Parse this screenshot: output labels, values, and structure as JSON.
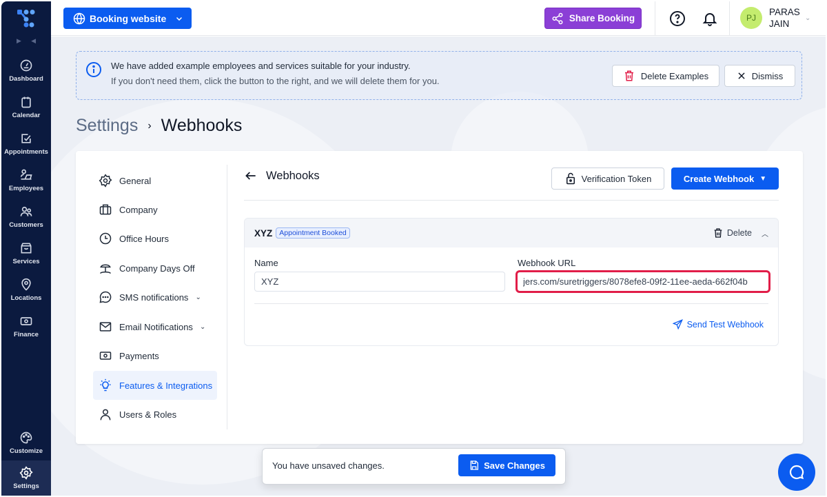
{
  "sidebar": {
    "logo": "app-logo",
    "collapse_icons": [
      "expand-icon",
      "collapse-icon"
    ],
    "items": [
      {
        "label": "Dashboard",
        "icon": "gauge-icon"
      },
      {
        "label": "Calendar",
        "icon": "calendar-icon"
      },
      {
        "label": "Appointments",
        "icon": "checkbox-icon"
      },
      {
        "label": "Employees",
        "icon": "employee-desk-icon"
      },
      {
        "label": "Customers",
        "icon": "users-icon"
      },
      {
        "label": "Services",
        "icon": "box-icon"
      },
      {
        "label": "Locations",
        "icon": "map-pin-icon"
      },
      {
        "label": "Finance",
        "icon": "money-icon"
      }
    ],
    "bottom_items": [
      {
        "label": "Customize",
        "icon": "palette-icon"
      },
      {
        "label": "Settings",
        "icon": "gear-icon",
        "active": true
      }
    ]
  },
  "topbar": {
    "site_selector": "Booking website",
    "share_button": "Share Booking",
    "help_icon": "help-icon",
    "bell_icon": "bell-icon",
    "user": {
      "initials": "PJ",
      "name": "PARAS JAIN"
    }
  },
  "banner": {
    "line1": "We have added example employees and services suitable for your industry.",
    "line2": "If you don't need them, click the button to the right, and we will delete them for you.",
    "delete_button": "Delete Examples",
    "dismiss_button": "Dismiss"
  },
  "breadcrumb": {
    "parent": "Settings",
    "separator": "›",
    "current": "Webhooks"
  },
  "settings_menu": [
    {
      "label": "General",
      "icon": "gear-icon"
    },
    {
      "label": "Company",
      "icon": "briefcase-icon"
    },
    {
      "label": "Office Hours",
      "icon": "clock-icon"
    },
    {
      "label": "Company Days Off",
      "icon": "beach-icon"
    },
    {
      "label": "SMS notifications",
      "icon": "chat-bubble-icon",
      "expandable": true
    },
    {
      "label": "Email Notifications",
      "icon": "mail-icon",
      "expandable": true
    },
    {
      "label": "Payments",
      "icon": "money-icon"
    },
    {
      "label": "Features & Integrations",
      "icon": "lightbulb-icon",
      "active": true
    },
    {
      "label": "Users & Roles",
      "icon": "user-icon"
    }
  ],
  "webhooks": {
    "title": "Webhooks",
    "verification_token_button": "Verification Token",
    "create_button": "Create Webhook",
    "item": {
      "name": "XYZ",
      "badge": "Appointment Booked",
      "delete_label": "Delete",
      "name_label": "Name",
      "name_value": "XYZ",
      "url_label": "Webhook URL",
      "url_value": "jers.com/suretriggers/8078efe8-09f2-11ee-aeda-662f04b",
      "send_test_label": "Send Test Webhook"
    }
  },
  "savebar": {
    "message": "You have unsaved changes.",
    "save_button": "Save Changes"
  },
  "chat_icon": "chat-support-icon",
  "colors": {
    "primary": "#0b5cf0",
    "share": "#8b3fd6",
    "sidebar": "#0b1a3f",
    "highlight": "#e11d48",
    "avatar": "#c4ec6e"
  }
}
